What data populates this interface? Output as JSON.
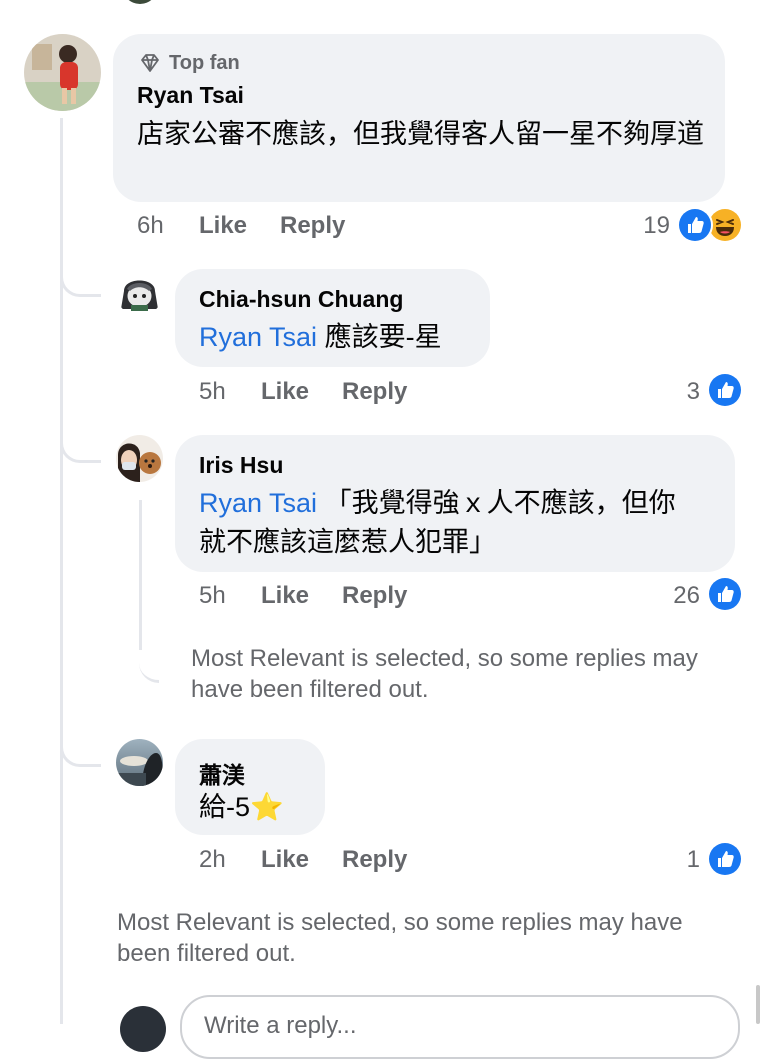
{
  "top_comment": {
    "badge": "Top fan",
    "author": "Ryan Tsai",
    "text": "店家公審不應該，但我覺得客人留一星不夠厚道",
    "time": "6h",
    "like_label": "Like",
    "reply_label": "Reply",
    "reaction_count": "19",
    "reactions": [
      "like-icon",
      "haha-icon"
    ]
  },
  "replies": [
    {
      "author": "Chia-hsun Chuang",
      "mention": "Ryan Tsai",
      "text": "應該要-星",
      "time": "5h",
      "like_label": "Like",
      "reply_label": "Reply",
      "reaction_count": "3"
    },
    {
      "author": "Iris Hsu",
      "mention": "Ryan Tsai",
      "text_line1": "「我覺得強ｘ人不應該，但你",
      "text_line2": "就不應該這麼惹人犯罪」",
      "time": "5h",
      "like_label": "Like",
      "reply_label": "Reply",
      "reaction_count": "26",
      "filter_notice": "Most Relevant is selected, so some replies may have been filtered out."
    },
    {
      "author": "蕭渼",
      "text": "給-5",
      "emoji": "⭐",
      "time": "2h",
      "like_label": "Like",
      "reply_label": "Reply",
      "reaction_count": "1"
    }
  ],
  "thread_notice": "Most Relevant is selected, so some replies may have been filtered out.",
  "composer": {
    "placeholder": "Write a reply..."
  },
  "colors": {
    "bubble": "#f0f2f5",
    "link": "#216fdb",
    "like": "#1877f2",
    "meta": "#65676b"
  }
}
